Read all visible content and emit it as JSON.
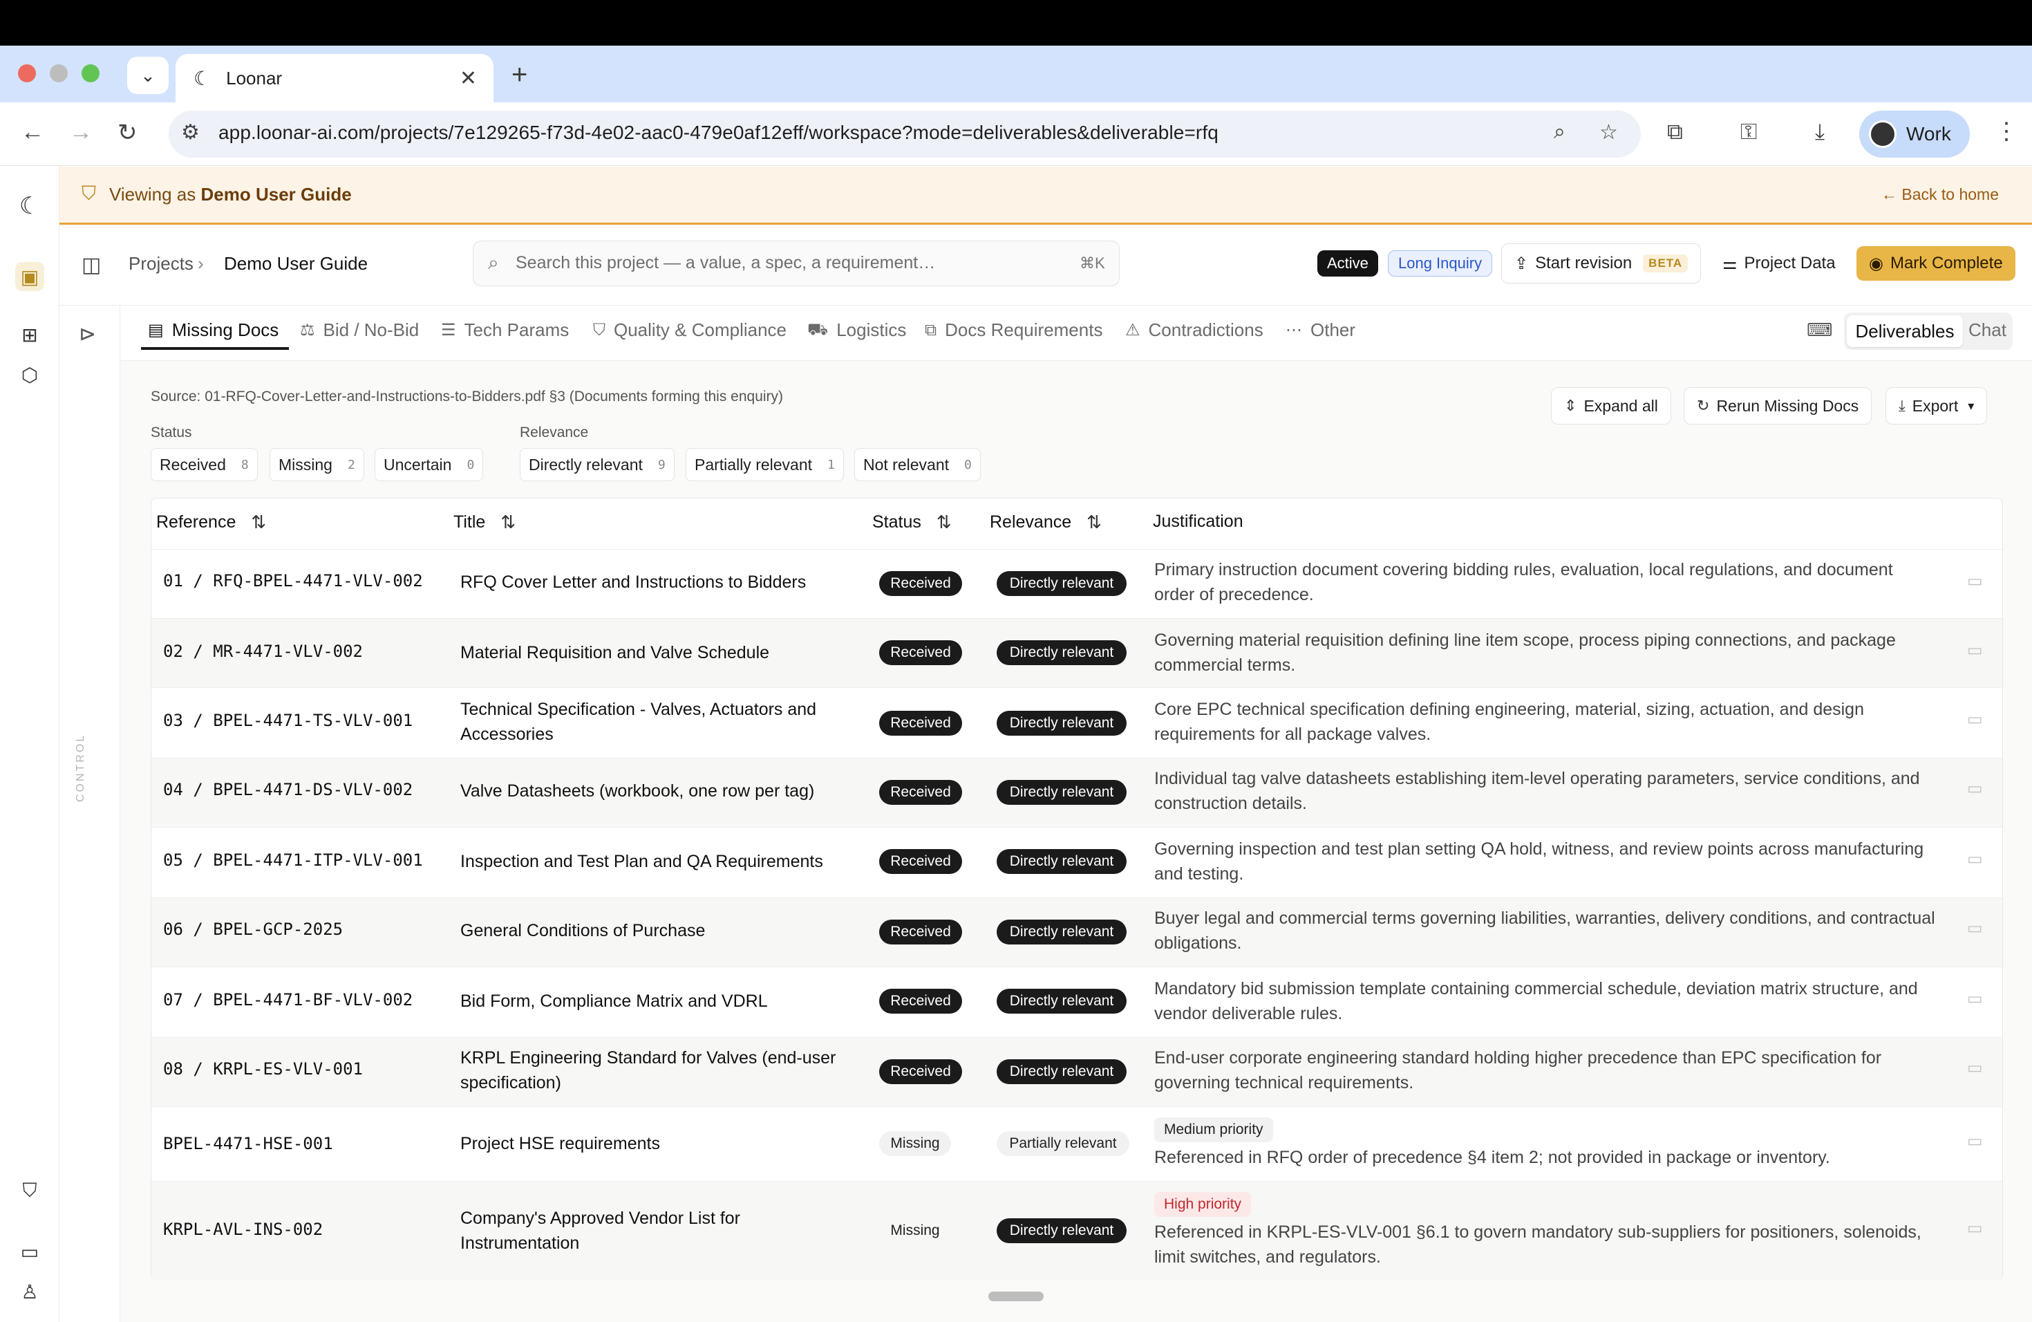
{
  "browser": {
    "tab_title": "Loonar",
    "tab_close": "✕",
    "new_tab": "+",
    "url": "app.loonar-ai.com/projects/7e129265-f73d-4e02-aac0-479e0af12eff/workspace?mode=deliverables&deliverable=rfq",
    "profile_label": "Work"
  },
  "banner": {
    "prefix": "Viewing as ",
    "user": "Demo User Guide",
    "back": "Back to home"
  },
  "header": {
    "crumb_projects": "Projects",
    "crumb_sep": "›",
    "crumb_current": "Demo User Guide",
    "search_placeholder": "Search this project — a value, a spec, a requirement…",
    "search_shortcut": "⌘K",
    "badge_active": "Active",
    "badge_long": "Long Inquiry",
    "start_revision": "Start revision",
    "beta": "BETA",
    "project_data": "Project Data",
    "mark_complete": "Mark Complete"
  },
  "control_label": "CONTROL",
  "tabs": [
    {
      "label": "Missing Docs",
      "icon": "file-icon"
    },
    {
      "label": "Bid / No-Bid",
      "icon": "scale-icon"
    },
    {
      "label": "Tech Params",
      "icon": "sliders-icon"
    },
    {
      "label": "Quality & Compliance",
      "icon": "shield-check-icon"
    },
    {
      "label": "Logistics",
      "icon": "truck-icon"
    },
    {
      "label": "Docs Requirements",
      "icon": "copy-icon"
    },
    {
      "label": "Contradictions",
      "icon": "warning-icon"
    },
    {
      "label": "Other",
      "icon": "dots-icon"
    }
  ],
  "view_switch": {
    "deliverables": "Deliverables",
    "chat": "Chat"
  },
  "content": {
    "source": "Source: 01-RFQ-Cover-Letter-and-Instructions-to-Bidders.pdf §3 (Documents forming this enquiry)",
    "status_label": "Status",
    "relevance_label": "Relevance",
    "status_filters": [
      {
        "label": "Received",
        "count": "8"
      },
      {
        "label": "Missing",
        "count": "2"
      },
      {
        "label": "Uncertain",
        "count": "0"
      }
    ],
    "relevance_filters": [
      {
        "label": "Directly relevant",
        "count": "9"
      },
      {
        "label": "Partially relevant",
        "count": "1"
      },
      {
        "label": "Not relevant",
        "count": "0"
      }
    ],
    "actions": {
      "expand": "Expand all",
      "rerun": "Rerun Missing Docs",
      "export": "Export"
    }
  },
  "table": {
    "headers": {
      "reference": "Reference",
      "title": "Title",
      "status": "Status",
      "relevance": "Relevance",
      "justification": "Justification"
    },
    "rows": [
      {
        "ref": "01 / RFQ-BPEL-4471-VLV-002",
        "title": "RFQ Cover Letter and Instructions to Bidders",
        "status": "Received",
        "relevance": "Directly relevant",
        "priority": "",
        "justification": "Primary instruction document covering bidding rules, evaluation, local regulations, and document order of precedence."
      },
      {
        "ref": "02 / MR-4471-VLV-002",
        "title": "Material Requisition and Valve Schedule",
        "status": "Received",
        "relevance": "Directly relevant",
        "priority": "",
        "justification": "Governing material requisition defining line item scope, process piping connections, and package commercial terms."
      },
      {
        "ref": "03 / BPEL-4471-TS-VLV-001",
        "title": "Technical Specification - Valves, Actuators and Accessories",
        "status": "Received",
        "relevance": "Directly relevant",
        "priority": "",
        "justification": "Core EPC technical specification defining engineering, material, sizing, actuation, and design requirements for all package valves."
      },
      {
        "ref": "04 / BPEL-4471-DS-VLV-002",
        "title": "Valve Datasheets (workbook, one row per tag)",
        "status": "Received",
        "relevance": "Directly relevant",
        "priority": "",
        "justification": "Individual tag valve datasheets establishing item-level operating parameters, service conditions, and construction details."
      },
      {
        "ref": "05 / BPEL-4471-ITP-VLV-001",
        "title": "Inspection and Test Plan and QA Requirements",
        "status": "Received",
        "relevance": "Directly relevant",
        "priority": "",
        "justification": "Governing inspection and test plan setting QA hold, witness, and review points across manufacturing and testing."
      },
      {
        "ref": "06 / BPEL-GCP-2025",
        "title": "General Conditions of Purchase",
        "status": "Received",
        "relevance": "Directly relevant",
        "priority": "",
        "justification": "Buyer legal and commercial terms governing liabilities, warranties, delivery conditions, and contractual obligations."
      },
      {
        "ref": "07 / BPEL-4471-BF-VLV-002",
        "title": "Bid Form, Compliance Matrix and VDRL",
        "status": "Received",
        "relevance": "Directly relevant",
        "priority": "",
        "justification": "Mandatory bid submission template containing commercial schedule, deviation matrix structure, and vendor deliverable rules."
      },
      {
        "ref": "08 / KRPL-ES-VLV-001",
        "title": "KRPL Engineering Standard for Valves (end-user specification)",
        "status": "Received",
        "relevance": "Directly relevant",
        "priority": "",
        "justification": "End-user corporate engineering standard holding higher precedence than EPC specification for governing technical requirements."
      },
      {
        "ref": "BPEL-4471-HSE-001",
        "title": "Project HSE requirements",
        "status": "Missing",
        "relevance": "Partially relevant",
        "priority": "Medium priority",
        "justification": "Referenced in RFQ order of precedence §4 item 2; not provided in package or inventory."
      },
      {
        "ref": "KRPL-AVL-INS-002",
        "title": "Company's Approved Vendor List for Instrumentation",
        "status": "Missing",
        "relevance": "Directly relevant",
        "priority": "High priority",
        "justification": "Referenced in KRPL-ES-VLV-001 §6.1 to govern mandatory sub-suppliers for positioners, solenoids, limit switches, and regulators."
      }
    ]
  }
}
